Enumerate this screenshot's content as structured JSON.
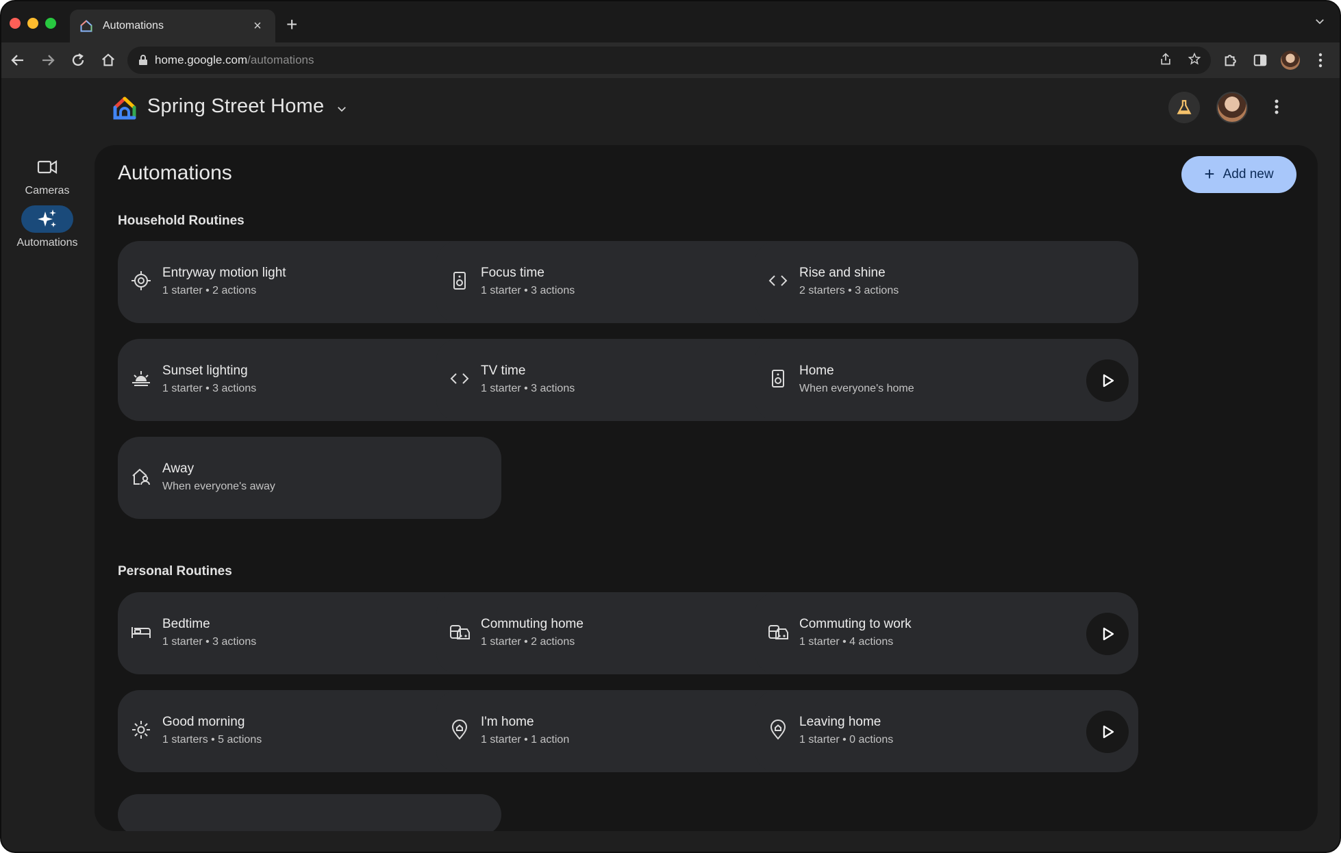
{
  "browser": {
    "tab_title": "Automations",
    "close_glyph": "×",
    "new_tab_glyph": "+",
    "url_host": "home.google.com",
    "url_path": "/automations"
  },
  "header": {
    "home_name": "Spring Street Home"
  },
  "rail": {
    "items": [
      {
        "label": "Cameras",
        "icon": "videocam-icon"
      },
      {
        "label": "Automations",
        "icon": "sparkle-icon",
        "active": true
      }
    ]
  },
  "main": {
    "title": "Automations",
    "add_label": "Add new",
    "add_glyph": "+",
    "household_title": "Household Routines",
    "personal_title": "Personal Routines",
    "household": [
      {
        "name": "Entryway motion light",
        "sub": "1 starter • 2 actions",
        "icon": "motion-sensor-icon",
        "play": true
      },
      {
        "name": "Focus time",
        "sub": "1 starter • 3 actions",
        "icon": "speaker-icon",
        "play": true
      },
      {
        "name": "Rise and shine",
        "sub": "2 starters • 3 actions",
        "icon": "code-icon",
        "play": false
      },
      {
        "name": "Sunset lighting",
        "sub": "1 starter • 3 actions",
        "icon": "sunset-icon",
        "play": true
      },
      {
        "name": "TV time",
        "sub": "1 starter • 3 actions",
        "icon": "code-icon",
        "play": false
      },
      {
        "name": "Home",
        "sub": "When everyone's home",
        "icon": "speaker-icon",
        "play": true
      },
      {
        "name": "Away",
        "sub": "When everyone's away",
        "icon": "away-home-icon",
        "play": false
      }
    ],
    "personal": [
      {
        "name": "Bedtime",
        "sub": "1 starter • 3 actions",
        "icon": "bed-icon",
        "play": true
      },
      {
        "name": "Commuting home",
        "sub": "1 starter • 2 actions",
        "icon": "commute-icon",
        "play": true
      },
      {
        "name": "Commuting to work",
        "sub": "1 starter • 4 actions",
        "icon": "commute-icon",
        "play": true
      },
      {
        "name": "Good morning",
        "sub": "1 starters • 5 actions",
        "icon": "sun-icon",
        "play": true
      },
      {
        "name": "I'm home",
        "sub": "1 starter • 1 action",
        "icon": "location-pin-icon",
        "play": true
      },
      {
        "name": "Leaving home",
        "sub": "1 starter • 0 actions",
        "icon": "location-pin-icon",
        "play": true
      }
    ]
  },
  "colors": {
    "accent_button": "#a8c7fa",
    "rail_active": "#1a4a7a",
    "card_bg": "#292a2d",
    "panel_bg": "#161616"
  }
}
